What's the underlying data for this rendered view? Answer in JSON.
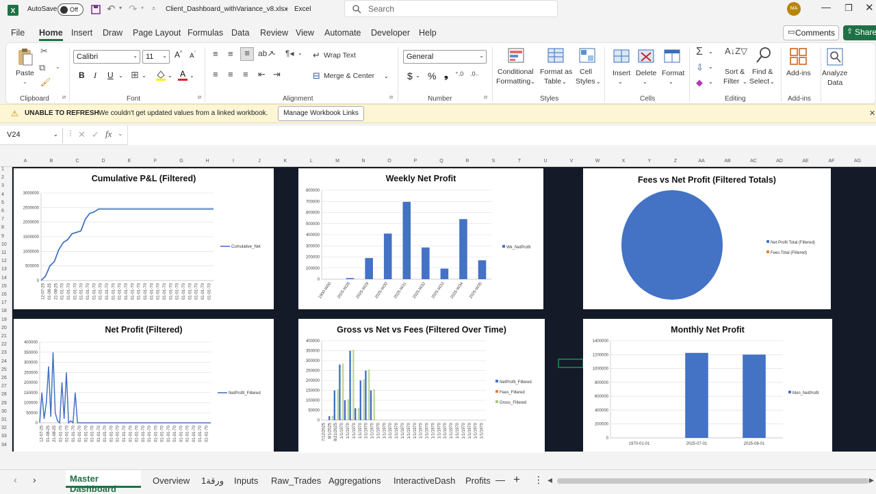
{
  "titlebar": {
    "autosave": "AutoSave",
    "toggle": "Off",
    "filename": "Client_Dashboard_withVariance_v8.xlsx",
    "separator": "-",
    "app": "Excel",
    "search_placeholder": "Search",
    "avatar": "MA"
  },
  "tabs": [
    "File",
    "Home",
    "Insert",
    "Draw",
    "Page Layout",
    "Formulas",
    "Data",
    "Review",
    "View",
    "Automate",
    "Developer",
    "Help"
  ],
  "actions": {
    "comments": "Comments",
    "share": "Share"
  },
  "ribbon": {
    "clipboard": {
      "paste": "Paste",
      "group": "Clipboard"
    },
    "font": {
      "name": "Calibri",
      "size": "11",
      "group": "Font",
      "bold": "B",
      "italic": "I",
      "underline": "U"
    },
    "alignment": {
      "wrap": "Wrap Text",
      "merge": "Merge & Center",
      "group": "Alignment"
    },
    "number": {
      "format": "General",
      "group": "Number",
      "currency": "$",
      "percent": "%"
    },
    "styles": {
      "cond": "Conditional",
      "cond2": "Formatting",
      "table": "Format as",
      "table2": "Table",
      "cell": "Cell",
      "cell2": "Styles",
      "group": "Styles"
    },
    "cells": {
      "insert": "Insert",
      "delete": "Delete",
      "format": "Format",
      "group": "Cells"
    },
    "editing": {
      "sort": "Sort &",
      "sort2": "Filter",
      "find": "Find &",
      "find2": "Select",
      "group": "Editing"
    },
    "addins": {
      "addins": "Add-ins",
      "group": "Add-ins"
    },
    "analyze": {
      "l1": "Analyze",
      "l2": "Data"
    }
  },
  "msgbar": {
    "title": "UNABLE TO REFRESH",
    "text": "We couldn't get updated values from a linked workbook.",
    "button": "Manage Workbook Links"
  },
  "formula": {
    "namebox": "V24",
    "fx": "fx"
  },
  "columns": [
    "A",
    "B",
    "C",
    "D",
    "E",
    "F",
    "G",
    "H",
    "I",
    "J",
    "K",
    "L",
    "M",
    "N",
    "O",
    "P",
    "Q",
    "R",
    "S",
    "T",
    "U",
    "V",
    "W",
    "X",
    "Y",
    "Z",
    "AA",
    "AB",
    "AC",
    "AD",
    "AE",
    "AF",
    "AG"
  ],
  "rows": [
    "1",
    "2",
    "3",
    "4",
    "5",
    "6",
    "7",
    "8",
    "9",
    "10",
    "11",
    "12",
    "13",
    "14",
    "15",
    "16",
    "17",
    "18",
    "19",
    "20",
    "21",
    "22",
    "23",
    "24",
    "25",
    "26",
    "27",
    "28",
    "29",
    "30",
    "31",
    "32",
    "33",
    "34"
  ],
  "sheets": [
    "Master Dashboard",
    "Overview",
    "ورقة1",
    "Inputs",
    "Raw_Trades",
    "Aggregations",
    "InteractiveDash",
    "Profits_"
  ],
  "chart_data": [
    {
      "type": "line",
      "title": "Cumulative P&L (Filtered)",
      "ylim": [
        0,
        3000000
      ],
      "yticks": [
        "0",
        "500000",
        "1000000",
        "1500000",
        "2000000",
        "2500000",
        "3000000"
      ],
      "xlabels": [
        "12-07-25",
        "01-08-25",
        "21-08-25",
        "01-01-70",
        "01-01-70",
        "01-01-70",
        "01-01-70",
        "01-01-70",
        "01-01-70",
        "01-01-70",
        "01-01-70",
        "01-01-70",
        "01-01-70",
        "01-01-70",
        "01-01-70",
        "01-01-70",
        "01-01-70",
        "01-01-70",
        "01-01-70",
        "01-01-70",
        "01-01-70",
        "01-01-70",
        "01-01-70",
        "01-01-70",
        "01-01-70",
        "01-01-70",
        "01-01-70"
      ],
      "series": [
        {
          "name": "Cumulative_Net",
          "color": "#4472c4",
          "values": [
            0,
            150000,
            500000,
            650000,
            1050000,
            1300000,
            1400000,
            1600000,
            1650000,
            1700000,
            2100000,
            2300000,
            2350000,
            2450000,
            2450000,
            2450000,
            2450000,
            2450000,
            2450000,
            2450000,
            2450000,
            2450000,
            2450000,
            2450000,
            2450000,
            2450000,
            2450000,
            2450000,
            2450000,
            2450000,
            2450000,
            2450000,
            2450000,
            2450000,
            2450000,
            2450000,
            2450000,
            2450000,
            2450000,
            2450000
          ]
        }
      ]
    },
    {
      "type": "bar",
      "title": "Weekly Net Profit",
      "ylim": [
        0,
        800000
      ],
      "yticks": [
        "0",
        "100000",
        "200000",
        "300000",
        "400000",
        "500000",
        "600000",
        "700000",
        "800000"
      ],
      "categories": [
        "1900-W00",
        "2025-W28",
        "2025-W29",
        "2025-W30",
        "2025-W31",
        "2025-W32",
        "2025-W33",
        "2025-W34",
        "2025-W35"
      ],
      "series": [
        {
          "name": "Wk_NetProfit",
          "color": "#4472c4",
          "values": [
            0,
            10000,
            190000,
            410000,
            695000,
            285000,
            95000,
            540000,
            170000
          ]
        }
      ]
    },
    {
      "type": "pie",
      "title": "Fees vs Net Profit (Filtered Totals)",
      "series": [
        {
          "name": "Net Profit Total (Filtered)",
          "color": "#4472c4",
          "value": 100
        },
        {
          "name": "Fees Total (Filtered)",
          "color": "#ed7d31",
          "value": 0
        }
      ]
    },
    {
      "type": "line",
      "title": "Net Profit (Filtered)",
      "ylim": [
        0,
        400000
      ],
      "yticks": [
        "0",
        "50000",
        "100000",
        "150000",
        "200000",
        "250000",
        "300000",
        "350000",
        "400000"
      ],
      "xlabels": [
        "12-07-25",
        "01-08-25",
        "21-08-25",
        "01-01-70",
        "01-01-70",
        "01-01-70",
        "01-01-70",
        "01-01-70",
        "01-01-70",
        "01-01-70",
        "01-01-70",
        "01-01-70",
        "01-01-70",
        "01-01-70",
        "01-01-70",
        "01-01-70",
        "01-01-70",
        "01-01-70",
        "01-01-70",
        "01-01-70",
        "01-01-70",
        "01-01-70",
        "01-01-70",
        "01-01-70",
        "01-01-70",
        "01-01-70",
        "01-01-70"
      ],
      "series": [
        {
          "name": "NetProfit_Filtered",
          "color": "#4472c4",
          "values": [
            0,
            150000,
            20000,
            100000,
            280000,
            30000,
            350000,
            50000,
            10000,
            0,
            200000,
            20000,
            250000,
            0,
            10000,
            0,
            150000,
            0,
            0,
            0,
            0,
            0,
            0,
            0,
            0,
            0,
            0,
            0,
            0,
            0,
            0,
            0,
            0,
            0,
            0,
            0,
            0,
            0,
            0,
            0,
            0,
            0,
            0,
            0,
            0,
            0,
            0,
            0,
            0,
            0,
            0,
            0,
            0,
            0,
            0,
            0,
            0,
            0,
            0,
            0,
            0,
            0,
            0,
            0,
            0,
            0,
            0,
            0,
            0,
            0,
            0,
            0,
            0,
            0,
            0,
            0,
            0,
            0
          ]
        }
      ]
    },
    {
      "type": "bar",
      "title": "Gross vs Net vs Fees (Filtered Over Time)",
      "ylim": [
        0,
        400000
      ],
      "yticks": [
        "0",
        "50000",
        "100000",
        "150000",
        "200000",
        "250000",
        "300000",
        "350000",
        "400000"
      ],
      "xlabels": [
        "7/12/2025",
        "8/1/2025",
        "8/21/2025",
        "1/1/1970",
        "1/1/1970",
        "1/1/1970",
        "1/1/1970",
        "1/1/1970",
        "1/1/1970",
        "1/1/1970",
        "1/1/1970",
        "1/1/1970",
        "1/1/1970",
        "1/1/1970",
        "1/1/1970",
        "1/1/1970",
        "1/1/1970",
        "1/1/1970",
        "1/1/1970",
        "1/1/1970",
        "1/1/1970",
        "1/1/1970",
        "1/1/1970",
        "1/1/1970",
        "1/1/1970",
        "1/1/1970",
        "1/1/1970"
      ],
      "series": [
        {
          "name": "NetProfit_Filtered",
          "color": "#4472c4",
          "values": [
            20000,
            150000,
            280000,
            100000,
            350000,
            60000,
            200000,
            250000,
            150000
          ]
        },
        {
          "name": "Fees_Filtered",
          "color": "#ed7d31",
          "values": [
            1000,
            2000,
            3000,
            1500,
            3000,
            1000,
            2000,
            2500,
            1500
          ]
        },
        {
          "name": "Gross_Filtered",
          "color": "#a9c47f",
          "values": [
            22000,
            155000,
            285000,
            105000,
            355000,
            62000,
            205000,
            255000,
            155000
          ]
        }
      ]
    },
    {
      "type": "bar",
      "title": "Monthly Net Profit",
      "ylim": [
        0,
        1400000
      ],
      "yticks": [
        "0",
        "200000",
        "400000",
        "600000",
        "800000",
        "1000000",
        "1200000",
        "1400000"
      ],
      "categories": [
        "1970-01-01",
        "2025-07-01",
        "2025-08-01"
      ],
      "series": [
        {
          "name": "Mon_NetProfit",
          "color": "#4472c4",
          "values": [
            0,
            1225000,
            1200000
          ]
        }
      ]
    }
  ]
}
